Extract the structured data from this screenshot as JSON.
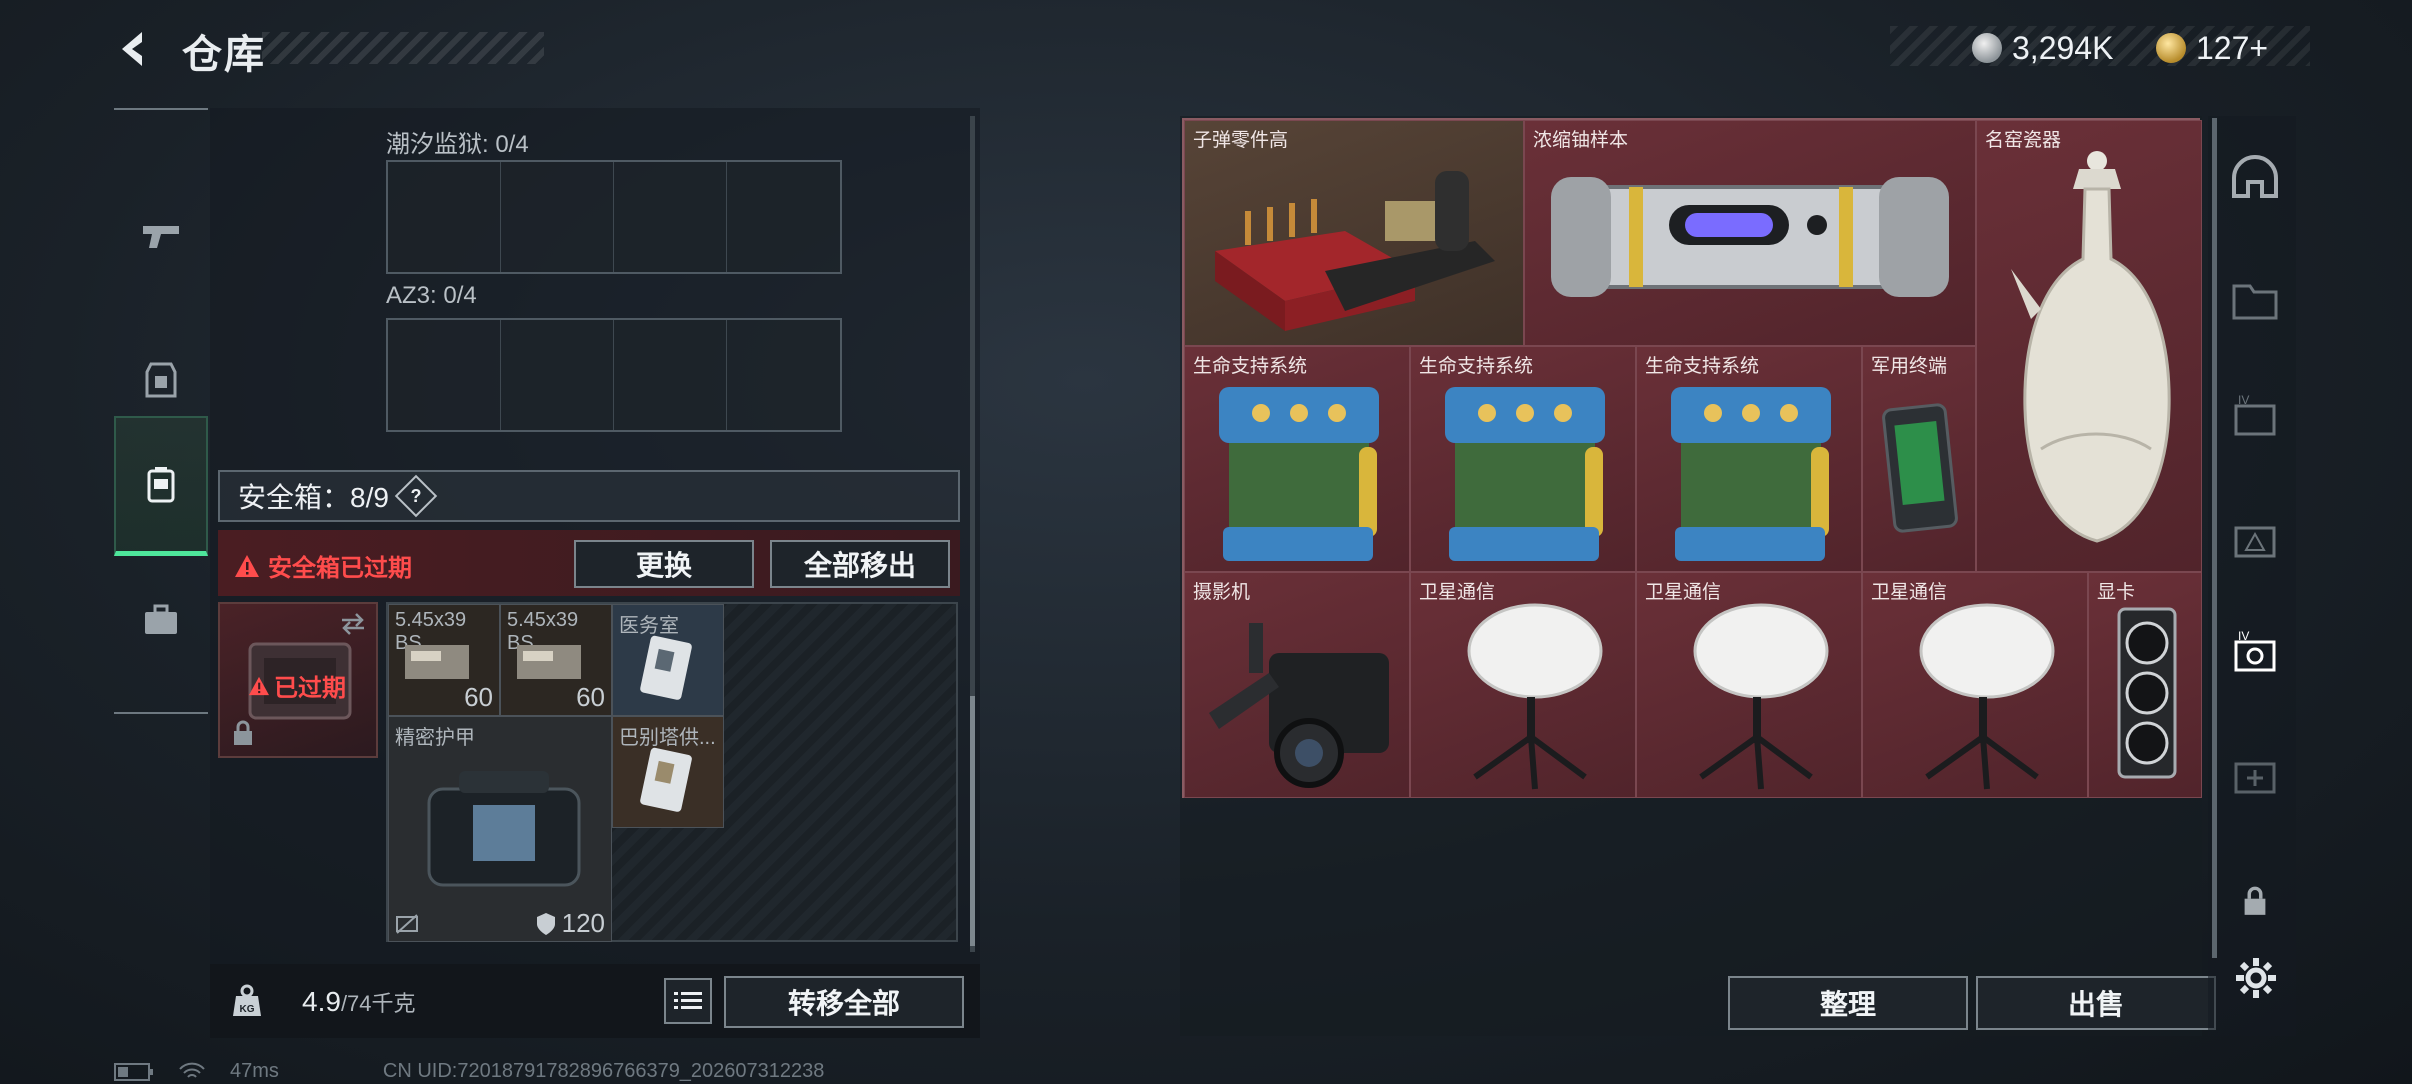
{
  "header": {
    "title": "仓库",
    "currencies": [
      {
        "icon": "silver-coin-icon",
        "value": "3,294K"
      },
      {
        "icon": "gold-coin-icon",
        "value": "127+"
      }
    ]
  },
  "left_tabs": [
    {
      "name": "weapon",
      "icon": "pistol-icon",
      "active": false
    },
    {
      "name": "gear",
      "icon": "vest-icon",
      "active": false
    },
    {
      "name": "safebox",
      "icon": "safebox-icon",
      "active": true
    },
    {
      "name": "case",
      "icon": "briefcase-icon",
      "active": false
    }
  ],
  "safebox_panel": {
    "slot_groups": [
      {
        "label": "潮汐监狱: 0/4"
      },
      {
        "label": "AZ3: 0/4"
      }
    ],
    "safebox_label": "安全箱：8/9",
    "help_label": "?",
    "expired_notice": "安全箱已过期",
    "replace_button": "更换",
    "move_all_out_button": "全部移出",
    "case_status": "已过期",
    "contents": [
      {
        "label": "5.45x39 BS",
        "count": "60"
      },
      {
        "label": "5.45x39 BS",
        "count": "60"
      },
      {
        "label": "医务室"
      },
      {
        "label": "精密护甲",
        "count": "120"
      },
      {
        "label": "巴别塔供..."
      }
    ],
    "weight": "4.9",
    "weight_max": "/74千克",
    "transfer_all_button": "转移全部"
  },
  "stash": {
    "items": [
      {
        "label": "子弹零件高"
      },
      {
        "label": "浓缩铀样本"
      },
      {
        "label": "名窑瓷器"
      },
      {
        "label": "生命支持系统"
      },
      {
        "label": "生命支持系统"
      },
      {
        "label": "生命支持系统"
      },
      {
        "label": "军用终端"
      },
      {
        "label": "摄影机"
      },
      {
        "label": "卫星通信"
      },
      {
        "label": "卫星通信"
      },
      {
        "label": "卫星通信"
      },
      {
        "label": "显卡"
      }
    ],
    "sort_button": "整理",
    "sell_button": "出售"
  },
  "status_bar": {
    "ping": "47ms",
    "uid": "CN UID:7201879178289676637​9_202607312238"
  },
  "colors": {
    "accent_green": "#4ee69b",
    "expired_red": "#ff4c4c",
    "stash_red": "#5a2a32"
  }
}
